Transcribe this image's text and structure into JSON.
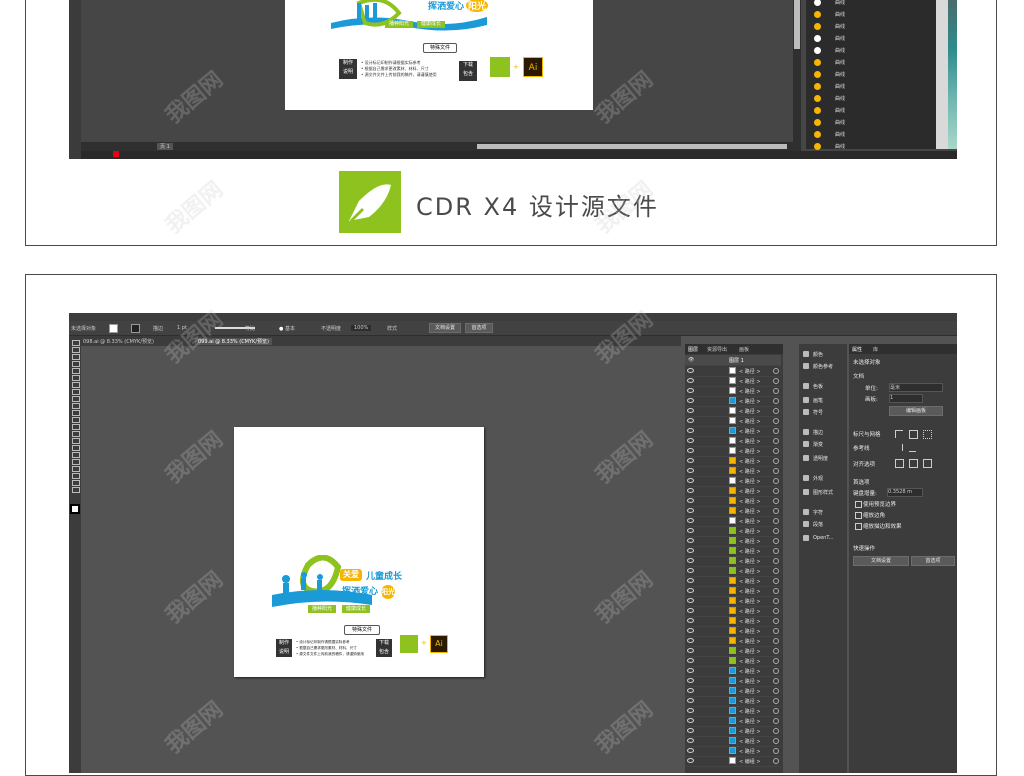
{
  "top_section": {
    "cdr_list_label": "曲线",
    "page_tab": "页 1",
    "caption": "CDR X4 设计源文件"
  },
  "artwork": {
    "headline_left": "关爱",
    "headline_right": "儿童成长",
    "subline": "挥洒爱心",
    "subline_accent": "阳光",
    "tag1": "播种阳光",
    "tag2": "健康成长",
    "info_button": "特殊文件",
    "make_label_1": "制作",
    "make_label_2": "说明",
    "notes": [
      "设计标记印制作请根据实际参考",
      "根据自己需求更改素材、材料、尺寸",
      "源文件文件上传前我的稿件，请谨慎使用"
    ],
    "download_label_1": "下载",
    "download_label_2": "包含",
    "ai_label": "Ai"
  },
  "illustrator": {
    "control_no_selection": "未选择对象",
    "stroke_label": "描边",
    "stroke_weight": "1 pt",
    "stroke_style": "等比",
    "brush_label": "基本",
    "opacity_label": "不透明度",
    "opacity_value": "100%",
    "style_label": "样式",
    "doc_setup_button": "文档设置",
    "prefs_button": "首选项",
    "doc_tab_1": "098.ai @ 8.33% (CMYK/预览)",
    "doc_tab_2": "099.ai @ 8.33% (CMYK/预览)",
    "layers_tabs": [
      "图层",
      "资源导出",
      "画板"
    ],
    "layer_name": "图层 1",
    "path_label": "< 路径 >",
    "group_label": "< 编组 >",
    "side_panels": [
      "颜色",
      "颜色参考",
      "色板",
      "画笔",
      "符号",
      "描边",
      "渐变",
      "透明度",
      "外观",
      "图形样式",
      "字符",
      "段落",
      "OpenT..."
    ],
    "props_tabs": [
      "属性",
      "库"
    ],
    "props": {
      "no_selection": "未选择对象",
      "document": "文档",
      "units_label": "单位:",
      "units_value": "毫米",
      "artboard_label": "画板:",
      "artboard_value": "1",
      "edit_artboard": "编辑画板",
      "rulers_grid": "标尺与网格",
      "guides": "参考线",
      "snap": "对齐选项",
      "prefs_section": "首选项",
      "keyboard_increment_label": "键盘增量:",
      "keyboard_increment_value": "0.3528 m",
      "checks": [
        "使用预览边界",
        "缩放边角",
        "缩放描边和效果"
      ],
      "quick_actions": "快速操作",
      "doc_setup": "文档设置",
      "prefs": "首选项"
    }
  },
  "watermark": "我图网",
  "colors": {
    "green": "#8dc21f",
    "blue": "#1a9ad6",
    "yellow": "#f7b500",
    "dark_ui": "#535353",
    "panel": "#3c3c3c"
  }
}
